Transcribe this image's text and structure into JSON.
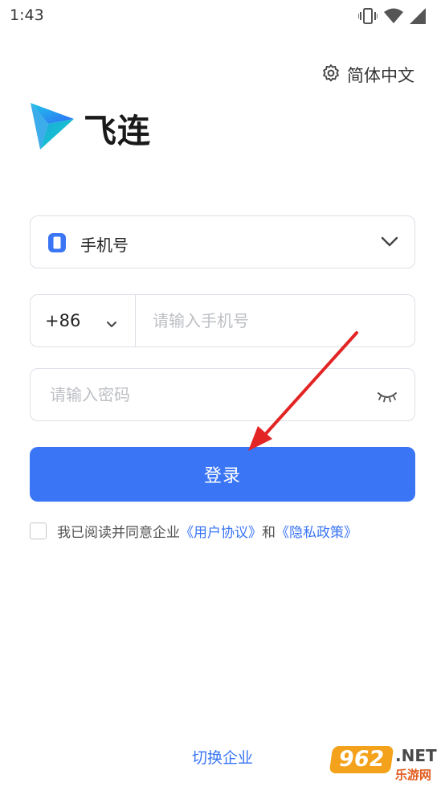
{
  "status_bar": {
    "time": "1:43"
  },
  "header": {
    "language_label": "简体中文"
  },
  "brand": {
    "name": "飞连"
  },
  "login_type": {
    "label": "手机号"
  },
  "phone": {
    "country_code": "+86",
    "placeholder": "请输入手机号"
  },
  "password": {
    "placeholder": "请输入密码"
  },
  "login_button": {
    "label": "登录"
  },
  "agreement": {
    "prefix": "我已阅读并同意企业",
    "user_agreement": "《用户协议》",
    "conjunction": "和",
    "privacy_policy": "《隐私政策》"
  },
  "footer": {
    "switch_enterprise": "切换企业"
  },
  "watermark": {
    "badge": "962",
    "domain": ".NET",
    "site_name": "乐游网"
  },
  "colors": {
    "accent": "#3a75f5",
    "annotation_arrow": "#e32424",
    "watermark_orange": "#f4a21b"
  }
}
